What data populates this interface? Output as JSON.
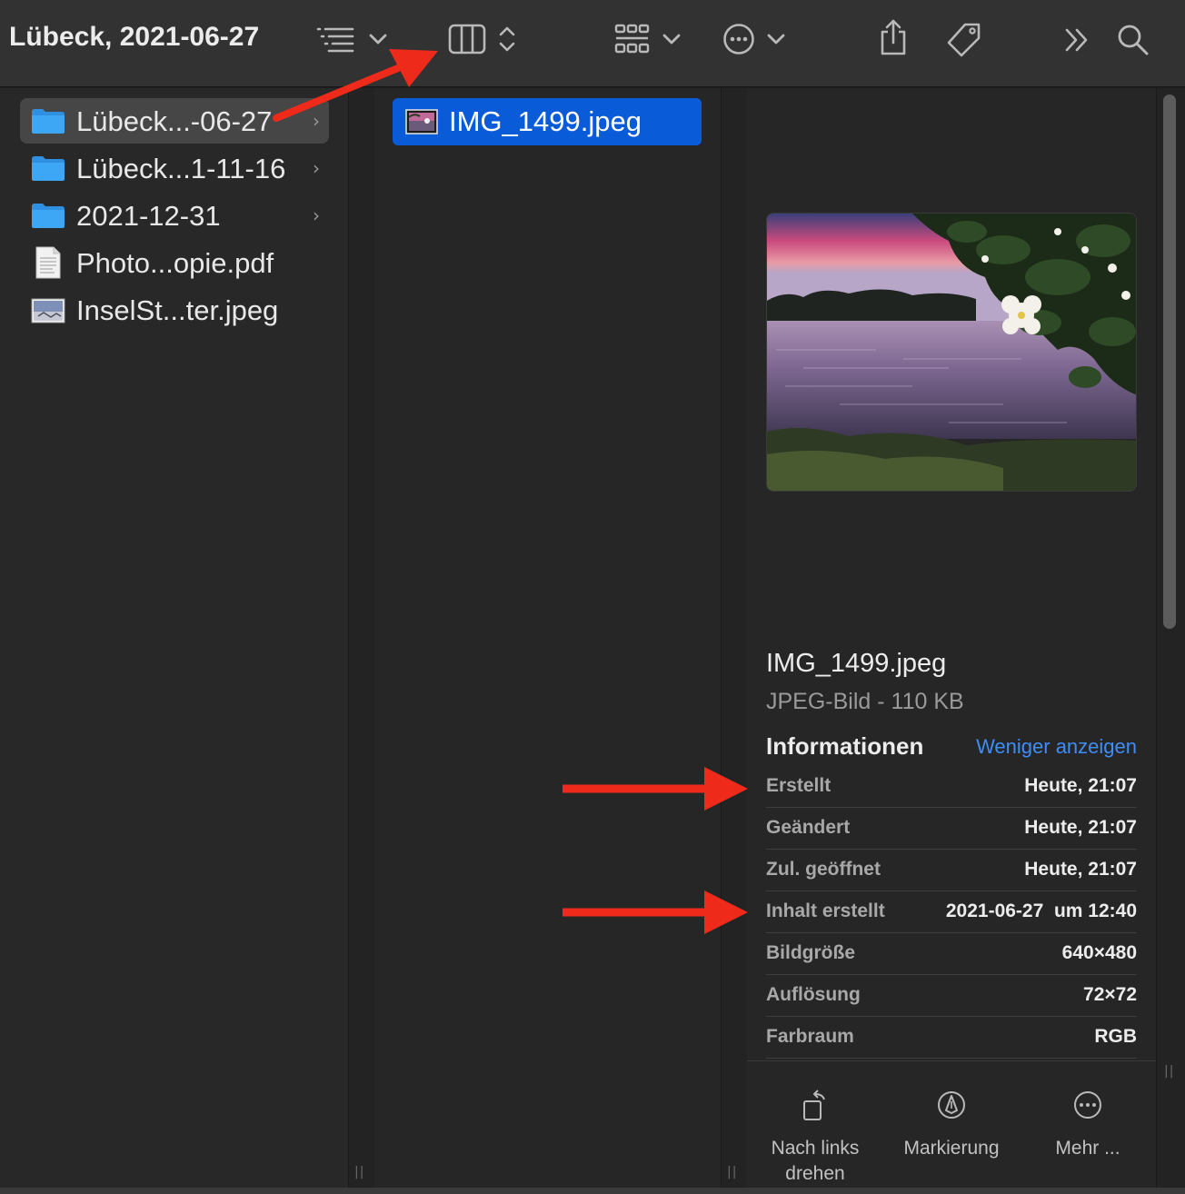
{
  "window": {
    "title": "Lübeck, 2021-06-27"
  },
  "toolbar": {
    "icons": [
      "list-view-icon",
      "chevron-down-icon",
      "column-view-icon",
      "up-down-chevron-icon",
      "gallery-grid-icon",
      "chevron-down-icon",
      "ellipsis-circle-icon",
      "chevron-down-icon",
      "share-icon",
      "tag-icon",
      "double-chevron-right-icon",
      "search-icon"
    ]
  },
  "sidebar_column": {
    "items": [
      {
        "label": "Lübeck...-06-27",
        "icon": "folder-icon",
        "has_children": true,
        "chevron": "›"
      },
      {
        "label": "Lübeck...1-11-16",
        "icon": "folder-icon",
        "has_children": true,
        "chevron": "›"
      },
      {
        "label": "2021-12-31",
        "icon": "folder-icon",
        "has_children": true,
        "chevron": "›"
      },
      {
        "label": "Photo...opie.pdf",
        "icon": "pdf-document-icon",
        "has_children": false
      },
      {
        "label": "InselSt...ter.jpeg",
        "icon": "image-thumbnail-icon",
        "has_children": false
      }
    ]
  },
  "file_column": {
    "items": [
      {
        "label": "IMG_1499.jpeg",
        "icon": "image-thumbnail-icon",
        "selected": true
      }
    ]
  },
  "preview": {
    "file_name": "IMG_1499.jpeg",
    "kind_size": "JPEG-Bild - 110 KB",
    "info_heading": "Informationen",
    "less_link": "Weniger anzeigen",
    "rows": [
      {
        "key": "Erstellt",
        "value": "Heute, 21:07"
      },
      {
        "key": "Geändert",
        "value": "Heute, 21:07"
      },
      {
        "key": "Zul. geöffnet",
        "value": "Heute, 21:07"
      },
      {
        "key": "Inhalt erstellt",
        "value": "2021-06-27  um 12:40"
      },
      {
        "key": "Bildgröße",
        "value": "640×480"
      },
      {
        "key": "Auflösung",
        "value": "72×72"
      },
      {
        "key": "Farbraum",
        "value": "RGB"
      }
    ],
    "actions": [
      {
        "label": "Nach links drehen",
        "icon": "rotate-left-icon"
      },
      {
        "label": "Markierung",
        "icon": "markup-pen-icon"
      },
      {
        "label": "Mehr ...",
        "icon": "ellipsis-circle-icon"
      }
    ]
  },
  "colors": {
    "accent": "#0a5bd8",
    "link": "#3d8ef7",
    "annotation_arrow": "#ee2a1b",
    "folder": "#3ea7f5"
  },
  "grip": "||"
}
